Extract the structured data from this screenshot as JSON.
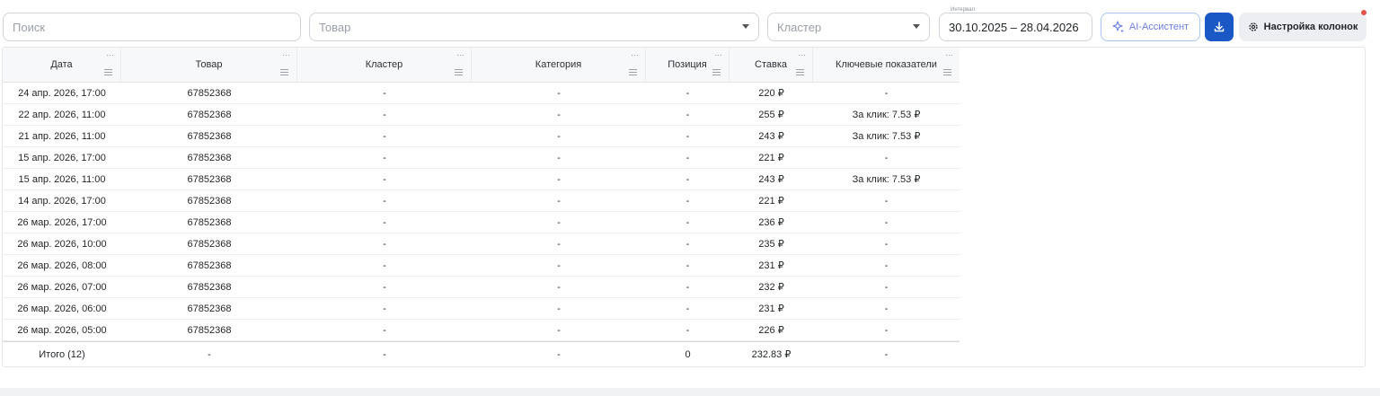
{
  "filters": {
    "search_placeholder": "Поиск",
    "product_placeholder": "Товар",
    "cluster_placeholder": "Кластер",
    "interval_label": "Интервал",
    "interval_value": "30.10.2025 – 28.04.2026",
    "ai_label": "AI-Ассистент",
    "columns_label": "Настройка колонок"
  },
  "table": {
    "headers": [
      "Дата",
      "Товар",
      "Кластер",
      "Категория",
      "Позиция",
      "Ставка",
      "Ключевые показатели"
    ],
    "rows": [
      [
        "24 апр. 2026, 17:00",
        "67852368",
        "-",
        "-",
        "-",
        "220 ₽",
        "-"
      ],
      [
        "22 апр. 2026, 11:00",
        "67852368",
        "-",
        "-",
        "-",
        "255 ₽",
        "За клик: 7.53 ₽"
      ],
      [
        "21 апр. 2026, 11:00",
        "67852368",
        "-",
        "-",
        "-",
        "243 ₽",
        "За клик: 7.53 ₽"
      ],
      [
        "15 апр. 2026, 17:00",
        "67852368",
        "-",
        "-",
        "-",
        "221 ₽",
        "-"
      ],
      [
        "15 апр. 2026, 11:00",
        "67852368",
        "-",
        "-",
        "-",
        "243 ₽",
        "За клик: 7.53 ₽"
      ],
      [
        "14 апр. 2026, 17:00",
        "67852368",
        "-",
        "-",
        "-",
        "221 ₽",
        "-"
      ],
      [
        "26 мар. 2026, 17:00",
        "67852368",
        "-",
        "-",
        "-",
        "236 ₽",
        "-"
      ],
      [
        "26 мар. 2026, 10:00",
        "67852368",
        "-",
        "-",
        "-",
        "235 ₽",
        "-"
      ],
      [
        "26 мар. 2026, 08:00",
        "67852368",
        "-",
        "-",
        "-",
        "231 ₽",
        "-"
      ],
      [
        "26 мар. 2026, 07:00",
        "67852368",
        "-",
        "-",
        "-",
        "232 ₽",
        "-"
      ],
      [
        "26 мар. 2026, 06:00",
        "67852368",
        "-",
        "-",
        "-",
        "231 ₽",
        "-"
      ],
      [
        "26 мар. 2026, 05:00",
        "67852368",
        "-",
        "-",
        "-",
        "226 ₽",
        "-"
      ]
    ],
    "total": [
      "Итого (12)",
      "-",
      "-",
      "-",
      "0",
      "232.83 ₽",
      "-"
    ]
  },
  "icons": {
    "ai": "sparkle-icon",
    "download": "download-icon",
    "columns": "gear-icon",
    "dropdown": "chevron-down-icon",
    "column_menu": "hamburger-icon",
    "column_more": "ellipsis-icon"
  },
  "colors": {
    "accent": "#1a58c6",
    "ai_text": "#6a7de0",
    "notification": "#e5534b"
  }
}
